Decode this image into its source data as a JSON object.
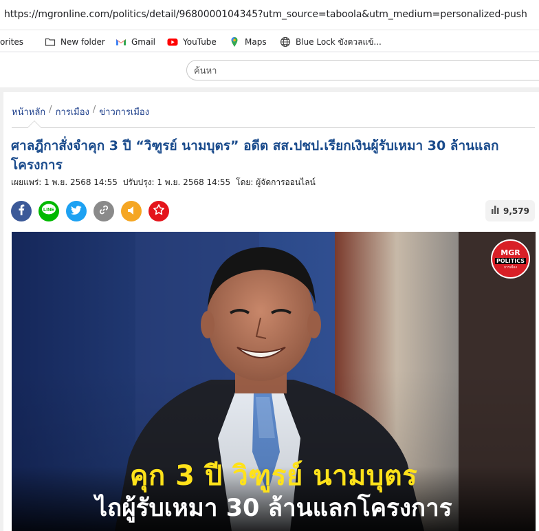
{
  "browser": {
    "url": "https://mgronline.com/politics/detail/9680000104345?utm_source=taboola&utm_medium=personalized-push",
    "bookmarks": [
      {
        "label": "orites",
        "icon": "star-icon"
      },
      {
        "label": "New folder",
        "icon": "folder-icon"
      },
      {
        "label": "Gmail",
        "icon": "gmail-icon"
      },
      {
        "label": "YouTube",
        "icon": "youtube-icon"
      },
      {
        "label": "Maps",
        "icon": "maps-pin-icon"
      },
      {
        "label": "Blue Lock ขังดวลแข้...",
        "icon": "globe-icon"
      }
    ]
  },
  "header": {
    "search_placeholder": "ค้นหา"
  },
  "article": {
    "breadcrumb": [
      "หน้าหลัก",
      "การเมือง",
      "ข่าวการเมือง"
    ],
    "breadcrumb_sep": "/",
    "title": "ศาลฎีกาสั่งจำคุก 3 ปี “วิฑูรย์ นามบุตร” อดีต สส.ปชป.เรียกเงินผู้รับเหมา 30 ล้านแลกโครงการ",
    "published": "เผยแพร่: 1 พ.ย. 2568 14:55",
    "updated": "ปรับปรุง: 1 พ.ย. 2568 14:55",
    "author": "โดย: ผู้จัดการออนไลน์",
    "views": "9,579",
    "share_buttons": [
      {
        "name": "facebook-share-button",
        "icon": "facebook-icon",
        "color": "#3b5998"
      },
      {
        "name": "line-share-button",
        "icon": "line-icon",
        "color": "#00b900"
      },
      {
        "name": "twitter-share-button",
        "icon": "twitter-icon",
        "color": "#1da1f2"
      },
      {
        "name": "copy-link-button",
        "icon": "link-icon",
        "color": "#8a8a8a"
      },
      {
        "name": "listen-button",
        "icon": "speaker-icon",
        "color": "#f5a623"
      },
      {
        "name": "bookmark-button",
        "icon": "star-icon",
        "color": "#e4141b"
      }
    ],
    "hero": {
      "caption_line1": "คุก 3 ปี วิฑูรย์ นามบุตร",
      "caption_line2": "ไถผู้รับเหมา 30 ล้านแลกโครงการ",
      "logo_top": "MGR",
      "logo_mid": "POLITICS",
      "logo_bottom": "การเมือง"
    }
  }
}
